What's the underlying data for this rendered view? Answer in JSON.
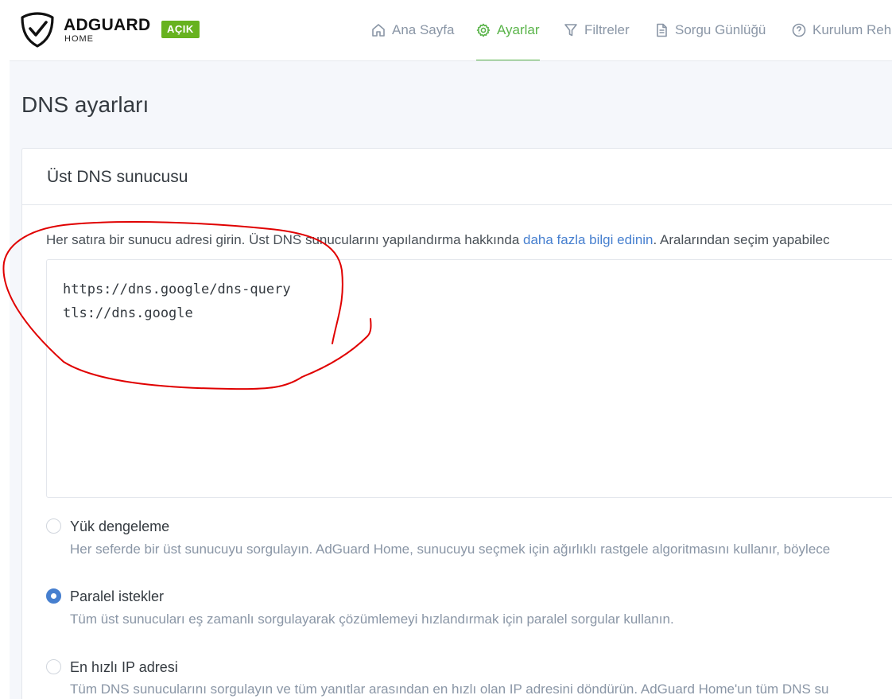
{
  "header": {
    "brand_name": "ADGUARD",
    "brand_sub": "HOME",
    "status": "AÇIK",
    "nav": [
      {
        "label": "Ana Sayfa",
        "icon": "home-icon"
      },
      {
        "label": "Ayarlar",
        "icon": "gear-icon"
      },
      {
        "label": "Filtreler",
        "icon": "filter-icon"
      },
      {
        "label": "Sorgu Günlüğü",
        "icon": "document-icon"
      },
      {
        "label": "Kurulum Reh",
        "icon": "help-circle-icon"
      }
    ]
  },
  "page": {
    "title": "DNS ayarları"
  },
  "upstream": {
    "title": "Üst DNS sunucusu",
    "help_text_before": "Her satıra bir sunucu adresi girin. Üst DNS sunucularını yapılandırma hakkında ",
    "help_link": "daha fazla bilgi edinin",
    "help_text_after": ". Aralarından seçim yapabilec",
    "servers": "https://dns.google/dns-query\ntls://dns.google",
    "options": [
      {
        "label": "Yük dengeleme",
        "description": "Her seferde bir üst sunucuyu sorgulayın. AdGuard Home, sunucuyu seçmek için ağırlıklı rastgele algoritmasını kullanır, böylece",
        "checked": false
      },
      {
        "label": "Paralel istekler",
        "description": "Tüm üst sunucuları eş zamanlı sorgulayarak çözümlemeyi hızlandırmak için paralel sorgular kullanın.",
        "checked": true
      },
      {
        "label": "En hızlı IP adresi",
        "description": "Tüm DNS sunucularını sorgulayın ve tüm yanıtlar arasından en hızlı olan IP adresini döndürün. AdGuard Home'un tüm DNS su",
        "checked": false
      }
    ]
  },
  "colors": {
    "accent_green": "#5ab44a",
    "badge_green": "#67b21f",
    "link_blue": "#467fcf",
    "annotation_red": "#e00000"
  }
}
